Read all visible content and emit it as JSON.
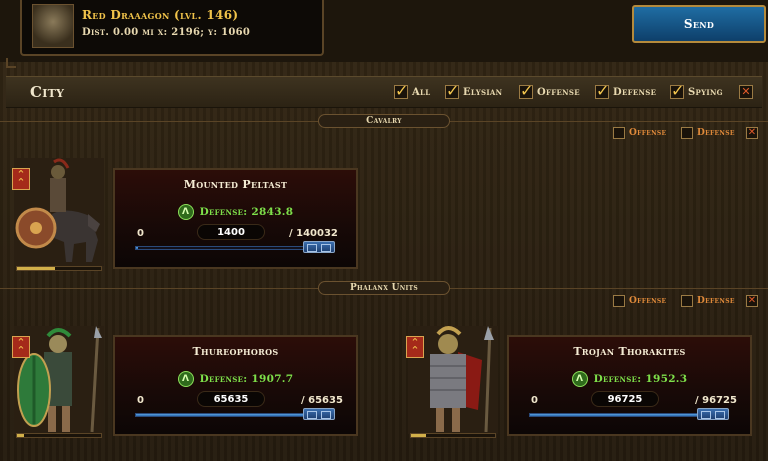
{
  "target": {
    "name": "Red Draaagon (lvl. 146)",
    "distance": "Dist. 0.00 mi  x: 2196; y: 1060"
  },
  "send_label": "Send",
  "city": {
    "title": "City",
    "filters": [
      {
        "label": "All",
        "checked": true
      },
      {
        "label": "Elysian",
        "checked": true
      },
      {
        "label": "Offense",
        "checked": true
      },
      {
        "label": "Defense",
        "checked": true
      },
      {
        "label": "Spying",
        "checked": true
      }
    ],
    "close": "✕"
  },
  "sections": [
    {
      "title": "Cavalry",
      "filters": {
        "offense": "Offense",
        "defense": "Defense",
        "close": "✕"
      },
      "units": [
        {
          "name": "Mounted Peltast",
          "defense": "Defense: 2843.8",
          "min": "0",
          "amount": "1400",
          "max": "/ 140032",
          "selected_fraction": 0.01
        }
      ]
    },
    {
      "title": "Phalanx Units",
      "filters": {
        "offense": "Offense",
        "defense": "Defense",
        "close": "✕"
      },
      "units": [
        {
          "name": "Thureophoros",
          "defense": "Defense: 1907.7",
          "min": "0",
          "amount": "65635",
          "max": "/ 65635",
          "selected_fraction": 1.0
        },
        {
          "name": "Trojan Thorakites",
          "defense": "Defense: 1952.3",
          "min": "0",
          "amount": "96725",
          "max": "/ 96725",
          "selected_fraction": 1.0
        }
      ]
    }
  ],
  "colors": {
    "accent": "#f0c34a",
    "defense_text": "#7ee04a",
    "send_button": "#1f6da3",
    "slider": "#2a6ab0"
  }
}
